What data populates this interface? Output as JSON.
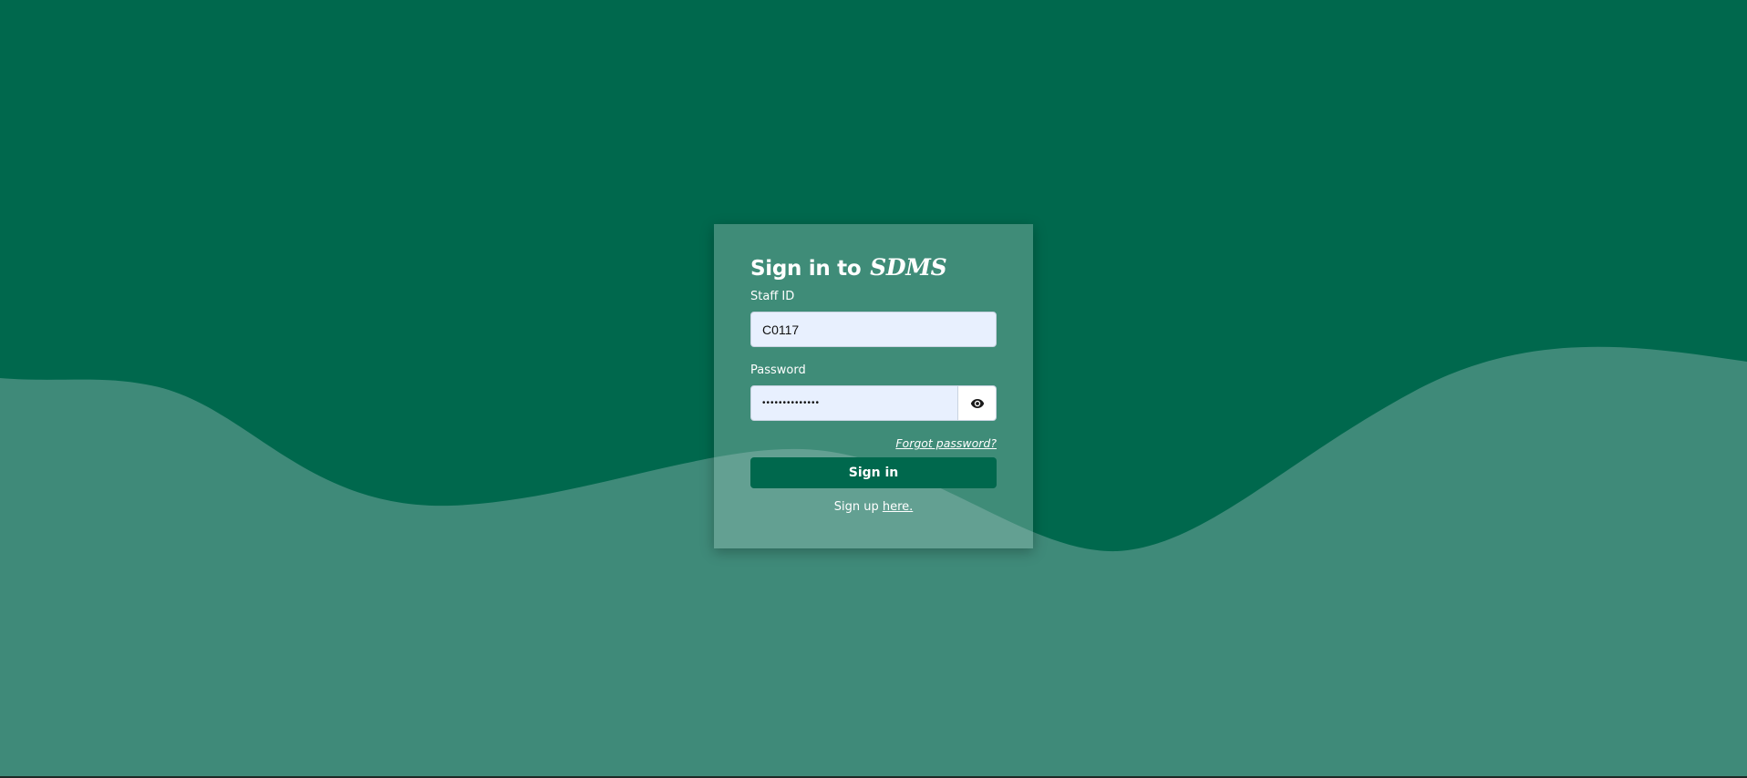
{
  "colors": {
    "background": "#00684d",
    "wave": "#3f8a79",
    "button": "#00684d",
    "input_background": "#e8f0fe"
  },
  "login": {
    "title_prefix": "Sign in to",
    "brand": "SDMS",
    "staff_id": {
      "label": "Staff ID",
      "value": "C0117"
    },
    "password": {
      "label": "Password",
      "masked_value": "••••••••••••••",
      "toggle_icon": "eye-icon"
    },
    "forgot_password_link": "Forgot password?",
    "submit_label": "Sign in",
    "signup_prefix": "Sign up",
    "signup_link": "here."
  }
}
